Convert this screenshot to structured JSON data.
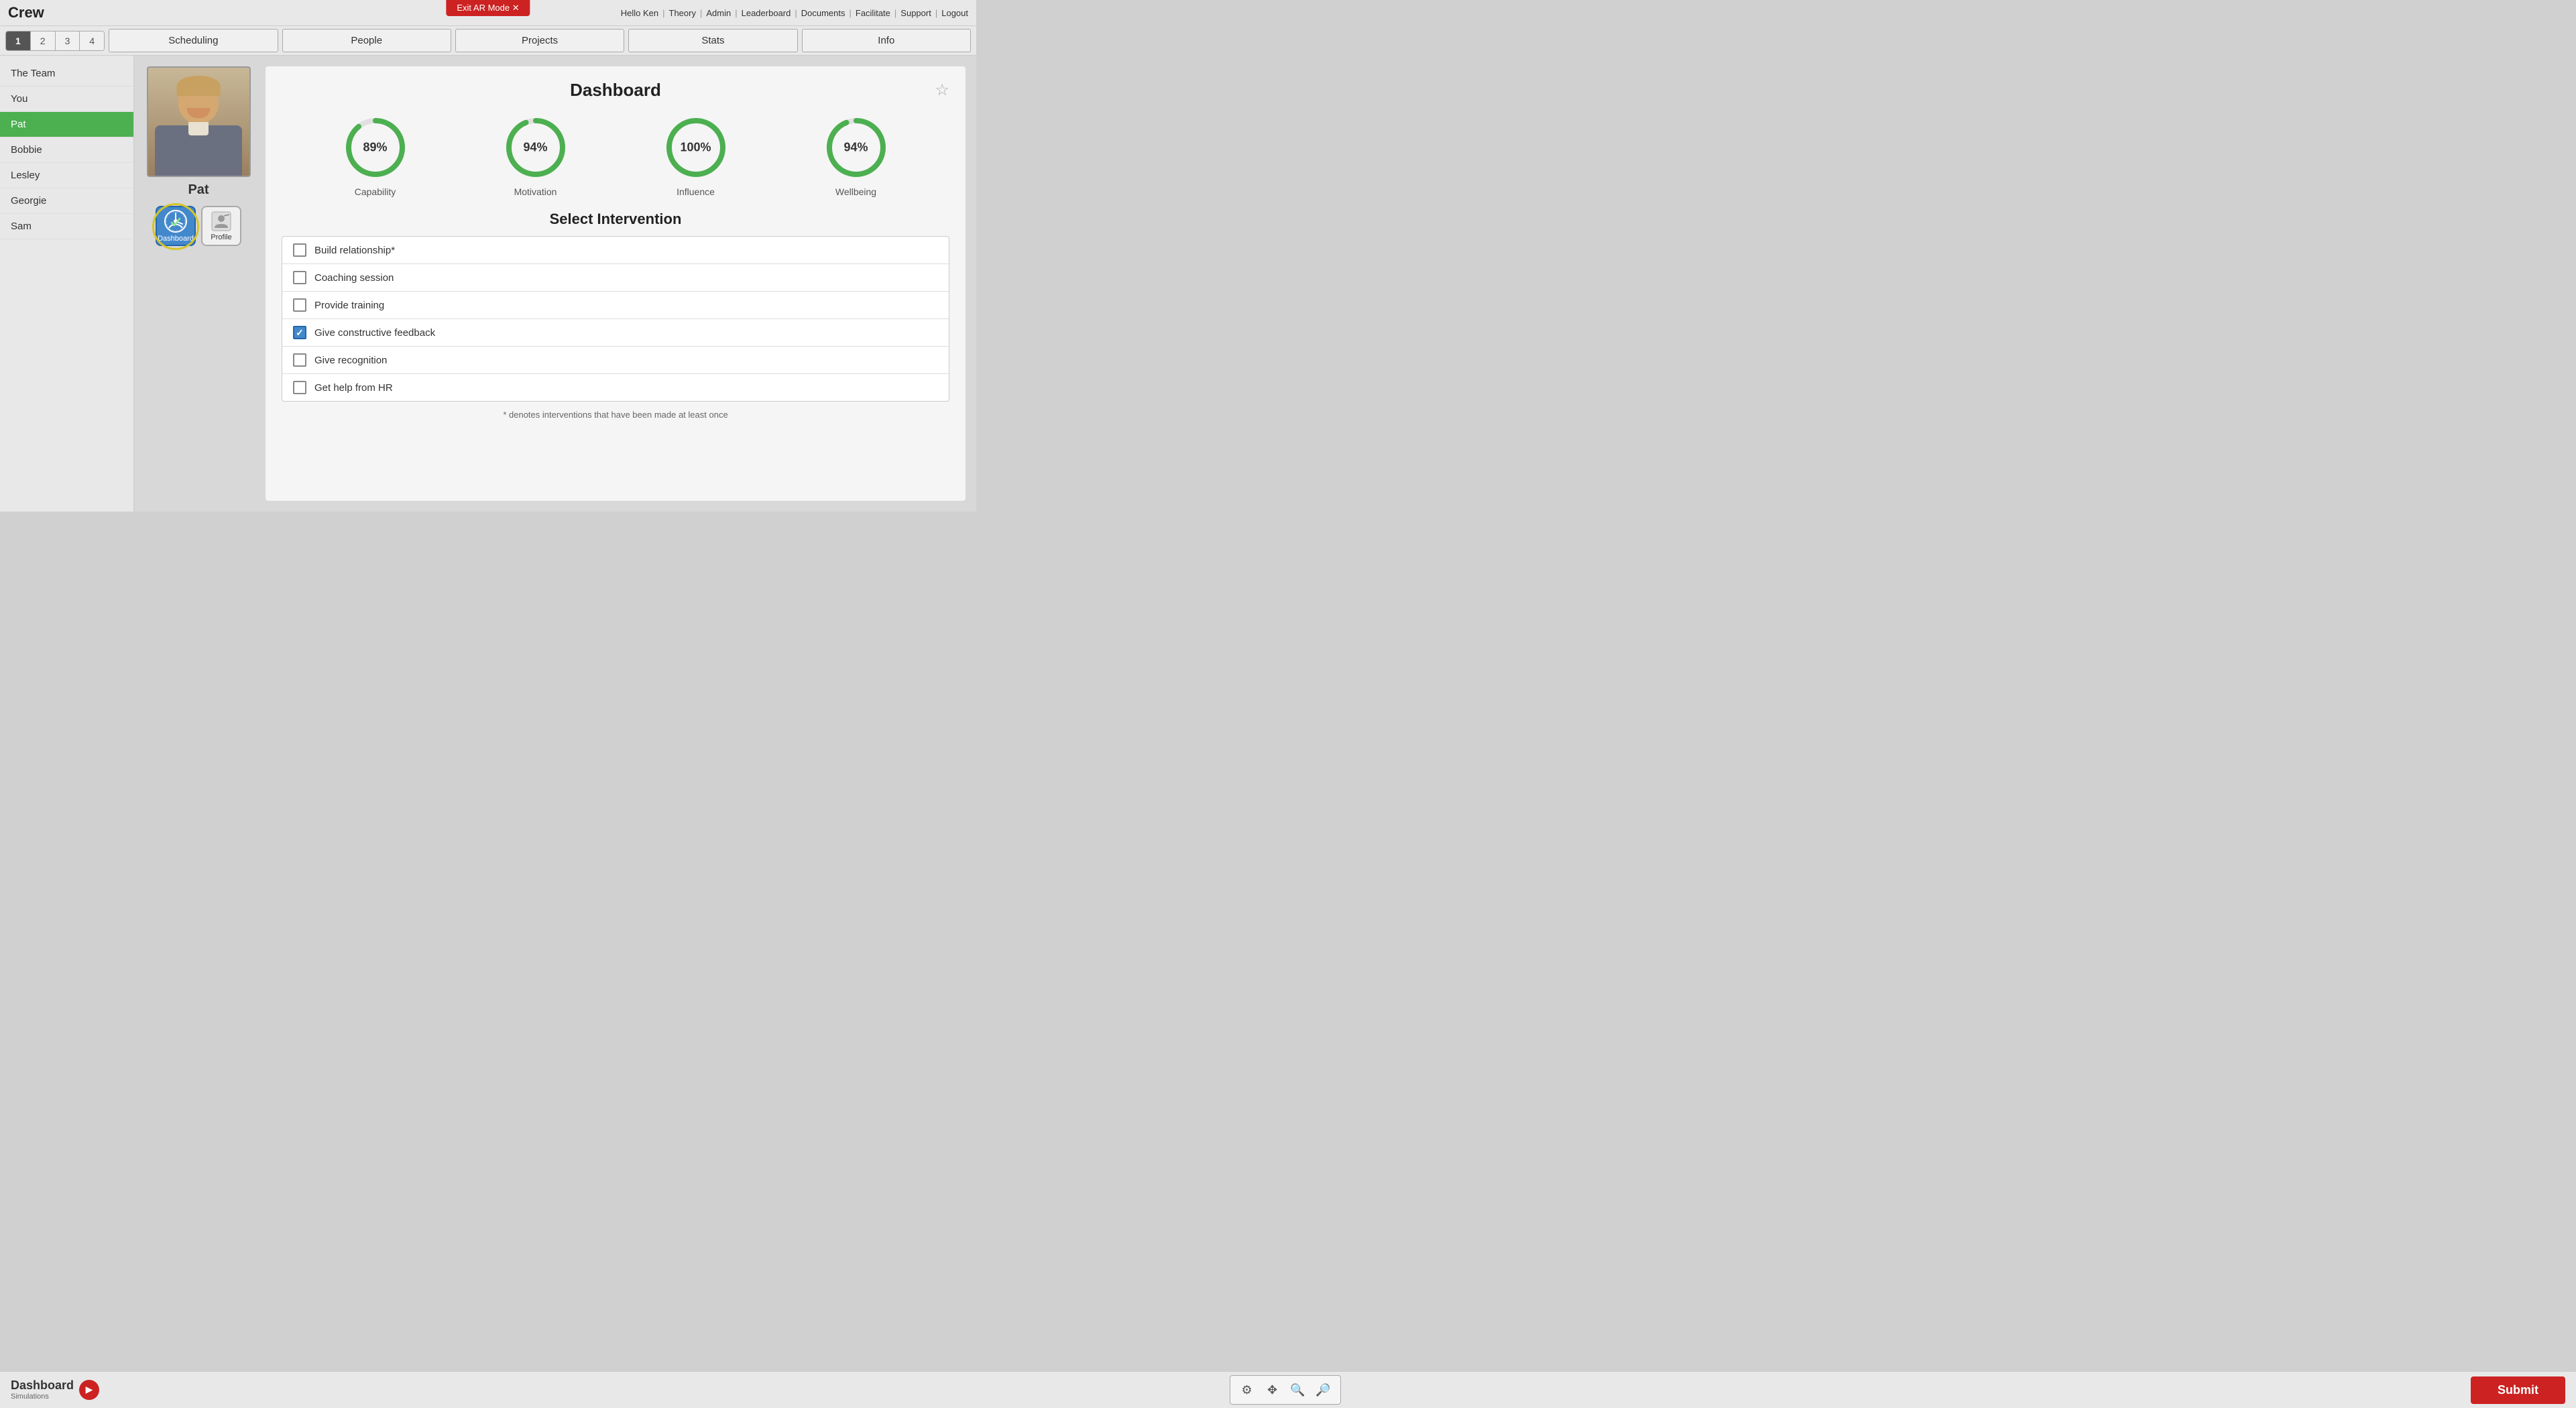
{
  "app": {
    "title": "Crew",
    "exit_ar_label": "Exit AR Mode ✕"
  },
  "top_nav": {
    "greeting": "Hello Ken",
    "items": [
      "Theory",
      "Admin",
      "Leaderboard",
      "Documents",
      "Facilitate",
      "Support",
      "Logout"
    ]
  },
  "step_tabs": {
    "tabs": [
      "1",
      "2",
      "3",
      "4"
    ],
    "active": 0
  },
  "main_nav": {
    "items": [
      "Scheduling",
      "People",
      "Projects",
      "Stats",
      "Info"
    ]
  },
  "sidebar": {
    "items": [
      "The Team",
      "You",
      "Pat",
      "Bobbie",
      "Lesley",
      "Georgie",
      "Sam"
    ],
    "active": "Pat"
  },
  "person": {
    "name": "Pat",
    "dashboard_label": "Dashboard",
    "profile_label": "Profile"
  },
  "dashboard": {
    "title": "Dashboard",
    "metrics": [
      {
        "label": "Capability",
        "value": 89,
        "display": "89%"
      },
      {
        "label": "Motivation",
        "value": 94,
        "display": "94%"
      },
      {
        "label": "Influence",
        "value": 100,
        "display": "100%"
      },
      {
        "label": "Wellbeing",
        "value": 94,
        "display": "94%"
      }
    ],
    "intervention_title": "Select Intervention",
    "interventions": [
      {
        "label": "Build relationship*",
        "checked": false
      },
      {
        "label": "Coaching session",
        "checked": false
      },
      {
        "label": "Provide training",
        "checked": false
      },
      {
        "label": "Give constructive feedback",
        "checked": true
      },
      {
        "label": "Give recognition",
        "checked": false
      },
      {
        "label": "Get help from HR",
        "checked": false
      }
    ],
    "footnote": "* denotes interventions that have been made at least once"
  },
  "bottom": {
    "logo_line1": "Dashboard",
    "logo_line2": "Simulations",
    "submit_label": "Submit"
  },
  "tools": {
    "gear": "⚙",
    "move": "✥",
    "zoom_in": "🔍",
    "zoom_out": "🔎"
  }
}
